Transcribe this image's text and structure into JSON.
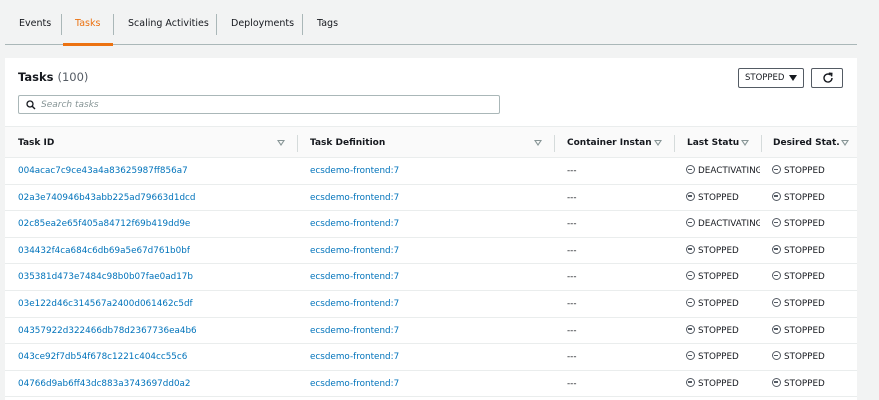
{
  "tabs": [
    {
      "label": "Events",
      "active": false
    },
    {
      "label": "Tasks",
      "active": true
    },
    {
      "label": "Scaling Activities",
      "active": false
    },
    {
      "label": "Deployments",
      "active": false
    },
    {
      "label": "Tags",
      "active": false
    }
  ],
  "panel": {
    "title": "Tasks",
    "count": "(100)",
    "filter_value": "STOPPED",
    "search_placeholder": "Search tasks"
  },
  "columns": [
    "Task ID",
    "Task Definition",
    "Container Instance",
    "Last Status",
    "Desired Stat..."
  ],
  "rows": [
    {
      "task_id": "004acac7c9ce43a4a83625987ff856a7",
      "task_def": "ecsdemo-frontend:7",
      "container": "---",
      "last_status": "DEACTIVATING",
      "desired_status": "STOPPED"
    },
    {
      "task_id": "02a3e740946b43abb225ad79663d1dcd",
      "task_def": "ecsdemo-frontend:7",
      "container": "---",
      "last_status": "STOPPED",
      "desired_status": "STOPPED"
    },
    {
      "task_id": "02c85ea2e65f405a84712f69b419dd9e",
      "task_def": "ecsdemo-frontend:7",
      "container": "---",
      "last_status": "DEACTIVATING",
      "desired_status": "STOPPED"
    },
    {
      "task_id": "034432f4ca684c6db69a5e67d761b0bf",
      "task_def": "ecsdemo-frontend:7",
      "container": "---",
      "last_status": "STOPPED",
      "desired_status": "STOPPED"
    },
    {
      "task_id": "035381d473e7484c98b0b07fae0ad17b",
      "task_def": "ecsdemo-frontend:7",
      "container": "---",
      "last_status": "STOPPED",
      "desired_status": "STOPPED"
    },
    {
      "task_id": "03e122d46c314567a2400d061462c5df",
      "task_def": "ecsdemo-frontend:7",
      "container": "---",
      "last_status": "STOPPED",
      "desired_status": "STOPPED"
    },
    {
      "task_id": "04357922d322466db78d2367736ea4b6",
      "task_def": "ecsdemo-frontend:7",
      "container": "---",
      "last_status": "STOPPED",
      "desired_status": "STOPPED"
    },
    {
      "task_id": "043ce92f7db54f678c1221c404cc55c6",
      "task_def": "ecsdemo-frontend:7",
      "container": "---",
      "last_status": "STOPPED",
      "desired_status": "STOPPED"
    },
    {
      "task_id": "04766d9ab6ff43dc883a3743697dd0a2",
      "task_def": "ecsdemo-frontend:7",
      "container": "---",
      "last_status": "STOPPED",
      "desired_status": "STOPPED"
    }
  ],
  "icons": {
    "refresh": "refresh-icon",
    "search": "search-icon",
    "status": "status-stopped-icon",
    "sort": "sort-caret-icon"
  },
  "colors": {
    "accent": "#ec7211",
    "link": "#0073bb"
  }
}
